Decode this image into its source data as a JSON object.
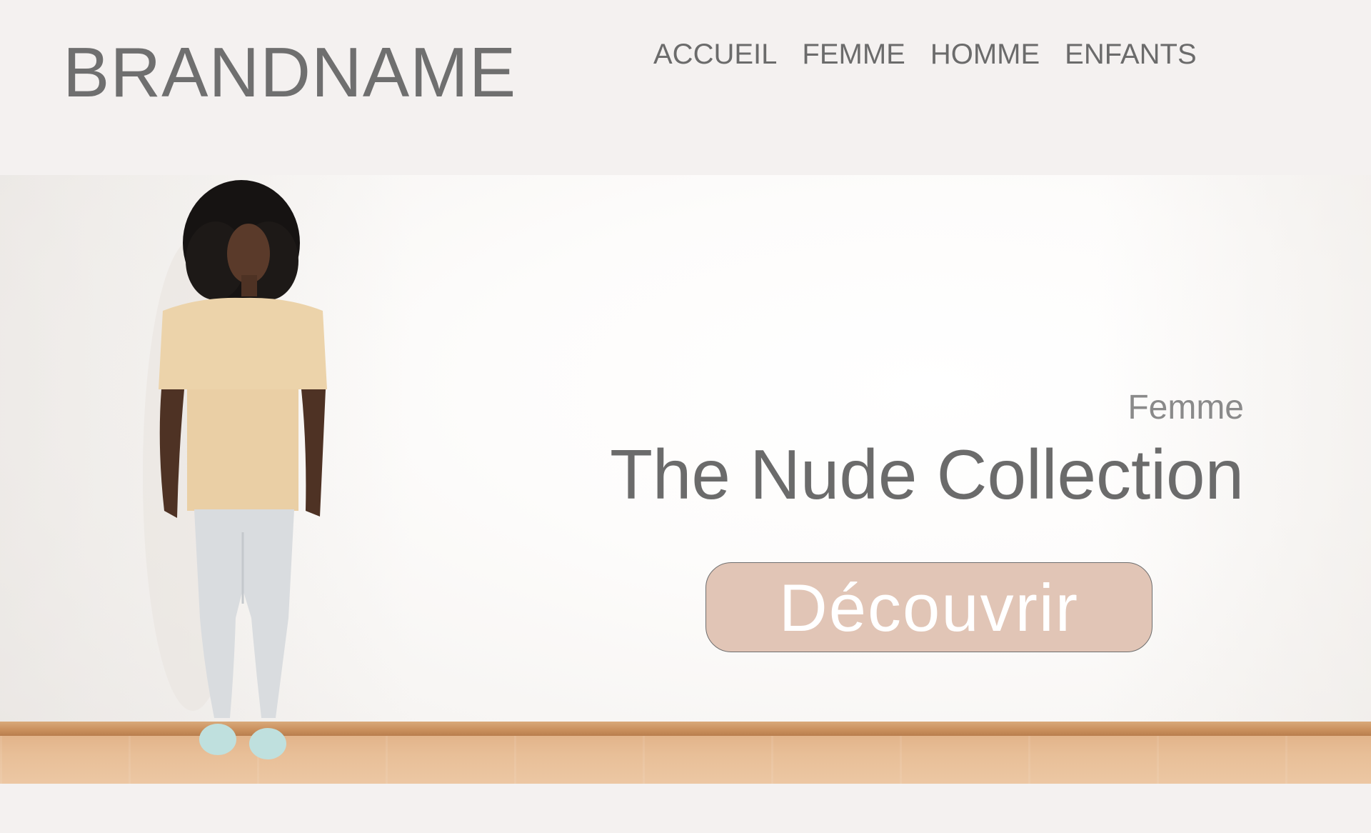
{
  "header": {
    "brand": "BRANDNAME",
    "nav": [
      {
        "label": "ACCUEIL"
      },
      {
        "label": "FEMME"
      },
      {
        "label": "HOMME"
      },
      {
        "label": "ENFANTS"
      }
    ]
  },
  "hero": {
    "eyebrow": "Femme",
    "headline": "The Nude Collection",
    "cta_label": "Découvrir"
  },
  "colors": {
    "background": "#f4f1f0",
    "text": "#6b6b6b",
    "cta_fill": "#e1c5b6",
    "cta_text": "#ffffff"
  }
}
